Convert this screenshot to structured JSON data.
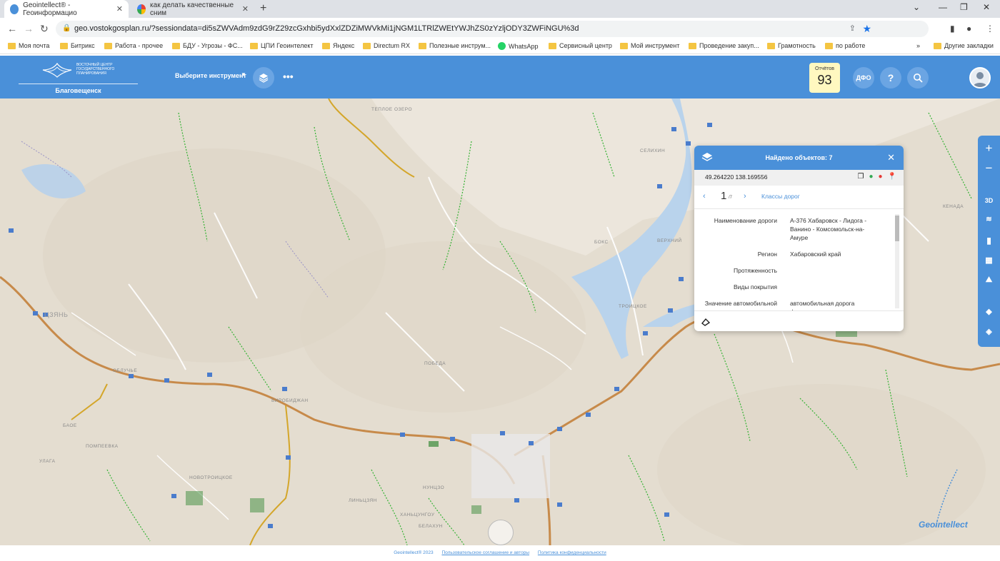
{
  "browser": {
    "tabs": [
      {
        "title": "Geointellect® - Геоинформацио",
        "active": true
      },
      {
        "title": "как делать качественные сним",
        "active": false
      }
    ],
    "url": "geo.vostokgosplan.ru/?sessiondata=di5sZWVAdm9zdG9rZ29zcGxhbi5ydXxlZDZiMWVkMi1jNGM1LTRlZWEtYWJhZS0zYzljODY3ZWFiNGU%3d",
    "bookmarks": [
      "Моя почта",
      "Битрикс",
      "Работа - прочее",
      "БДУ - Угрозы - ФС...",
      "ЦПИ Геоинтелект",
      "Яндекс",
      "Directum RX",
      "Полезные инструм...",
      "WhatsApp",
      "Сервисный центр",
      "Мой инструмент",
      "Проведение закуп...",
      "Грамотность",
      "по работе"
    ],
    "bookmarks_more": "»",
    "bookmarks_other": "Другие закладки"
  },
  "header": {
    "logo_text": "ВОСТОЧНЫЙ ЦЕНТР ГОСУДАРСТВЕННОГО ПЛАНИРОВАНИЯ",
    "city": "Благовещенск",
    "tool_select": "Выберите инструмент",
    "dots": "•••",
    "reports_label": "Отчётов",
    "reports_count": "93",
    "region_btn": "ДФО",
    "help_btn": "?"
  },
  "popup": {
    "title": "Найдено объектов: 7",
    "coords": "49.264220 138.169556",
    "page": "1",
    "page_of": "/7",
    "class_link": "Классы дорог",
    "attributes": [
      {
        "key": "Наименование дороги",
        "value": "А-376 Хабаровск - Лидога - Ванино - Комсомольск-на-Амуре"
      },
      {
        "key": "Регион",
        "value": "Хабаровский край"
      },
      {
        "key": "Протяженность",
        "value": ""
      },
      {
        "key": "Виды покрытия",
        "value": ""
      },
      {
        "key": "Значение автомобильной дороги",
        "value": "автомобильная дорога федерального значения"
      }
    ]
  },
  "side_controls": [
    "+",
    "−",
    "3D"
  ],
  "map_labels": [
    "ЦЗЯНЬ",
    "БИРОБИДЖАН",
    "УЛАГА",
    "БАОЕ",
    "ПОМПЕЕВКА",
    "НОВОТРОИЦКОЕ",
    "ОБЛУЧЬЕ",
    "ХАНЬЦУНГОУ",
    "ЛИНЬЦЗЯН",
    "НУНЦЗО",
    "БЕЛАХУН",
    "ПОБЕДА",
    "ТЕПЛОЕ ОЗЕРО",
    "КЕНАДА",
    "ТРОИЦКОЕ",
    "ВЕРХНИЙ",
    "СЕЛИХИН",
    "БОКС"
  ],
  "footer": {
    "copyright": "Geointellect® 2023",
    "agreement": "Пользовательское соглашение и авторы",
    "privacy": "Политика конфиденциальности"
  },
  "watermark": "Geointellect"
}
